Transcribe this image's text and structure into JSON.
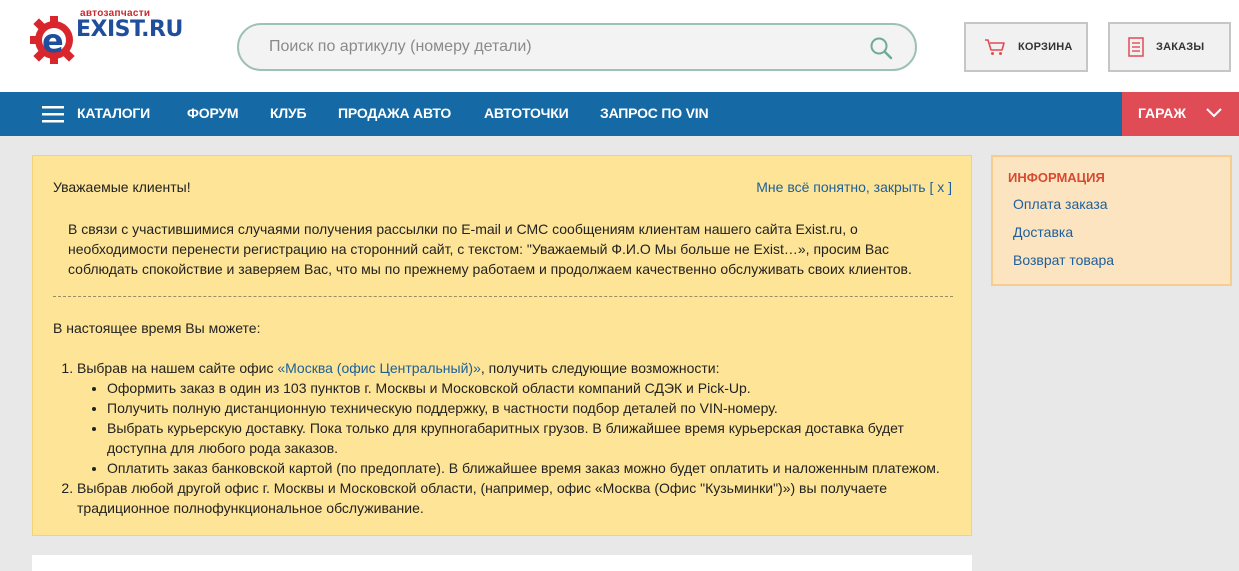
{
  "logo": {
    "subtitle": "автозапчасти",
    "name": "EXIST.RU"
  },
  "search": {
    "placeholder": "Поиск по артикулу (номеру детали)"
  },
  "header_buttons": {
    "cart": "КОРЗИНА",
    "orders": "ЗАКАЗЫ"
  },
  "nav": {
    "items": [
      "КАТАЛОГИ",
      "ФОРУМ",
      "КЛУБ",
      "ПРОДАЖА АВТО",
      "АВТОТОЧКИ",
      "ЗАПРОС ПО VIN"
    ],
    "garage": "ГАРАЖ"
  },
  "notice": {
    "greeting": "Уважаемые клиенты!",
    "close": "Мне всё понятно, закрыть [ x ]",
    "paragraph": "В связи с участившимися случаями получения рассылки по E-mail и СМС сообщениям клиентам нашего сайта Exist.ru, о необходимости перенести регистрацию на сторонний сайт, с текстом: \"Уважаемый Ф.И.О Мы больше не Exist…», просим Вас соблюдать спокойствие и заверяем Вас, что мы по прежнему работаем и продолжаем качественно обслуживать своих клиентов.",
    "now": "В настоящее время Вы можете:",
    "item1_before": "Выбрав на нашем сайте офис ",
    "item1_link": "«Москва (офис Центральный)»",
    "item1_after": ", получить следующие возможности:",
    "sub": [
      "Оформить заказ в один из 103 пунктов г. Москвы и Московской области компаний СДЭК и Pick-Up.",
      "Получить полную дистанционную техническую поддержку, в частности подбор деталей по VIN-номеру.",
      "Выбрать курьерскую доставку. Пока только для крупногабаритных грузов. В ближайшее время курьерская доставка будет доступна для любого рода заказов.",
      "Оплатить заказ банковской картой (по предоплате). В ближайшее время заказ можно будет оплатить и наложенным платежом."
    ],
    "item2": "Выбрав любой другой офис г. Москвы и Московской области, (например, офис «Москва (Офис \"Кузьминки\")») вы получаете традиционное полнофункциональное обслуживание."
  },
  "info": {
    "title": "ИНФОРМАЦИЯ",
    "links": [
      "Оплата заказа",
      "Доставка",
      "Возврат товара"
    ]
  },
  "colors": {
    "nav": "#1569a5",
    "garage": "#e04c55",
    "notice_bg": "#fde496",
    "link": "#1d5f9a",
    "info_title": "#d84a30"
  }
}
